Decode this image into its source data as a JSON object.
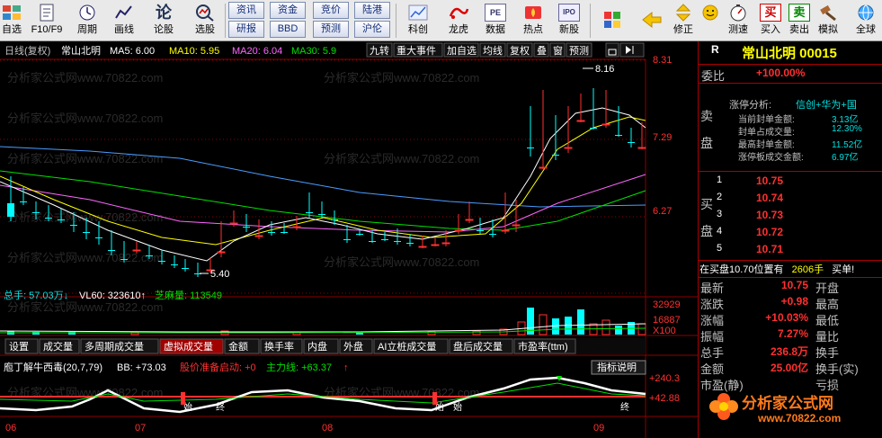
{
  "toolbar": {
    "items": [
      {
        "label": "自选",
        "icon": "grid-app-icon"
      },
      {
        "label": "F10/F9",
        "icon": "document-icon"
      },
      {
        "label": "周期",
        "icon": "clock-icon"
      },
      {
        "label": "画线",
        "icon": "pen-icon"
      },
      {
        "label": "论股",
        "icon": "forum-icon"
      },
      {
        "label": "选股",
        "icon": "stock-picker-icon"
      },
      {
        "label": "科创",
        "icon": "chart-tech-icon"
      },
      {
        "label": "龙虎",
        "icon": "dragon-tiger-icon"
      },
      {
        "label": "数据",
        "icon": "pe-data-icon"
      },
      {
        "label": "热点",
        "icon": "hot-icon"
      },
      {
        "label": "新股",
        "icon": "ipo-icon"
      },
      {
        "label": "修正",
        "icon": "correction-icon"
      },
      {
        "label": "测速",
        "icon": "speedtest-icon"
      },
      {
        "label": "买入",
        "icon": "buy-icon"
      },
      {
        "label": "卖出",
        "icon": "sell-icon"
      },
      {
        "label": "模拟",
        "icon": "simulate-icon"
      },
      {
        "label": "全球",
        "icon": "globe-icon"
      }
    ],
    "small_buttons": [
      "资讯",
      "资金",
      "竞价",
      "陆港",
      "研报",
      "BBD",
      "预测",
      "沪伦"
    ],
    "icon_glyphs": {
      "lun": "论",
      "buy": "买",
      "sell": "卖",
      "pe": "PE",
      "ipo": "IPO"
    }
  },
  "chart": {
    "header_title": "日线(复权)",
    "stock_name": "常山北明",
    "ma": [
      {
        "label": "MA5: 6.00",
        "color": "#ffffff"
      },
      {
        "label": "MA10: 5.95",
        "color": "#ffff00"
      },
      {
        "label": "MA20: 6.04",
        "color": "#ff66ff"
      },
      {
        "label": "MA30: 5.9",
        "color": "#00e000"
      }
    ],
    "tabs": [
      "九转",
      "重大事件",
      "加自选",
      "均线",
      "复权",
      "叠",
      "窗",
      "预测"
    ],
    "price_axis": [
      "8.31",
      "7.29",
      "6.27"
    ],
    "high_label": "8.16",
    "low_label": "5.40",
    "watermark": "分析家公式网www.70822.com",
    "colors": {
      "up": "#ff3030",
      "down": "#00ffff",
      "grid": "#8b0000"
    }
  },
  "volume": {
    "header": "总手: 57.03万↓",
    "vl": "VL60: 323610↑",
    "zhima": "芝麻量: 113549",
    "axis": [
      "32929",
      "16887",
      "X100"
    ]
  },
  "indicator_tabs": [
    "设置",
    "成交量",
    "多周期成交量",
    "虚拟成交量",
    "金额",
    "换手率",
    "内盘",
    "外盘",
    "AI立桩成交量",
    "盘后成交量",
    "市盈率(ttm)"
  ],
  "active_indicator_tab": "虚拟成交量",
  "indicator": {
    "title": "庖丁解牛西毒(20,7,79)",
    "bb": "BB: +73.03",
    "warn": "股价准备启动: +0",
    "main": "主力线: +63.37",
    "arrow": "↑",
    "help": "指标说明",
    "axis": [
      "+240.3",
      "+42.88"
    ],
    "markers": [
      "始",
      "始",
      "始",
      "终",
      "终"
    ]
  },
  "months": [
    "06",
    "07",
    "08",
    "09"
  ],
  "right": {
    "r": "R",
    "name": "常山北明 00015",
    "weibi_label": "委比",
    "weibi_value": "+100.00%",
    "sell_label": "卖盘",
    "buy_label": "买盘",
    "zt_title": "涨停分析:",
    "zt_tags": "信创+华为+国",
    "zt_rows": [
      {
        "k": "当前封单金额:",
        "v": "3.13亿"
      },
      {
        "k": "封单占成交量:",
        "v": "12.30%"
      },
      {
        "k": "最高封单金额:",
        "v": "11.52亿"
      },
      {
        "k": "涨停板成交金额:",
        "v": "6.97亿"
      }
    ],
    "bids": [
      {
        "level": "1",
        "price": "10.75"
      },
      {
        "level": "2",
        "price": "10.74"
      },
      {
        "level": "3",
        "price": "10.73"
      },
      {
        "level": "4",
        "price": "10.72"
      },
      {
        "level": "5",
        "price": "10.71"
      }
    ],
    "status_left": "在买盘10.70位置有",
    "status_qty": "2606手",
    "status_right": "买单!",
    "quotes": [
      {
        "k": "最新",
        "v": "10.75",
        "k2": "开盘"
      },
      {
        "k": "涨跌",
        "v": "+0.98",
        "k2": "最高"
      },
      {
        "k": "涨幅",
        "v": "+10.03%",
        "k2": "最低"
      },
      {
        "k": "振幅",
        "v": "7.27%",
        "k2": "量比"
      },
      {
        "k": "总手",
        "v": "236.8万",
        "k2": "换手"
      },
      {
        "k": "金额",
        "v": "25.00亿",
        "k2": "换手(实)"
      },
      {
        "k": "市盈(静)",
        "v": "",
        "k2": "亏损"
      }
    ],
    "logo_text": "分析家公式网",
    "logo_url": "www.70822.com"
  }
}
